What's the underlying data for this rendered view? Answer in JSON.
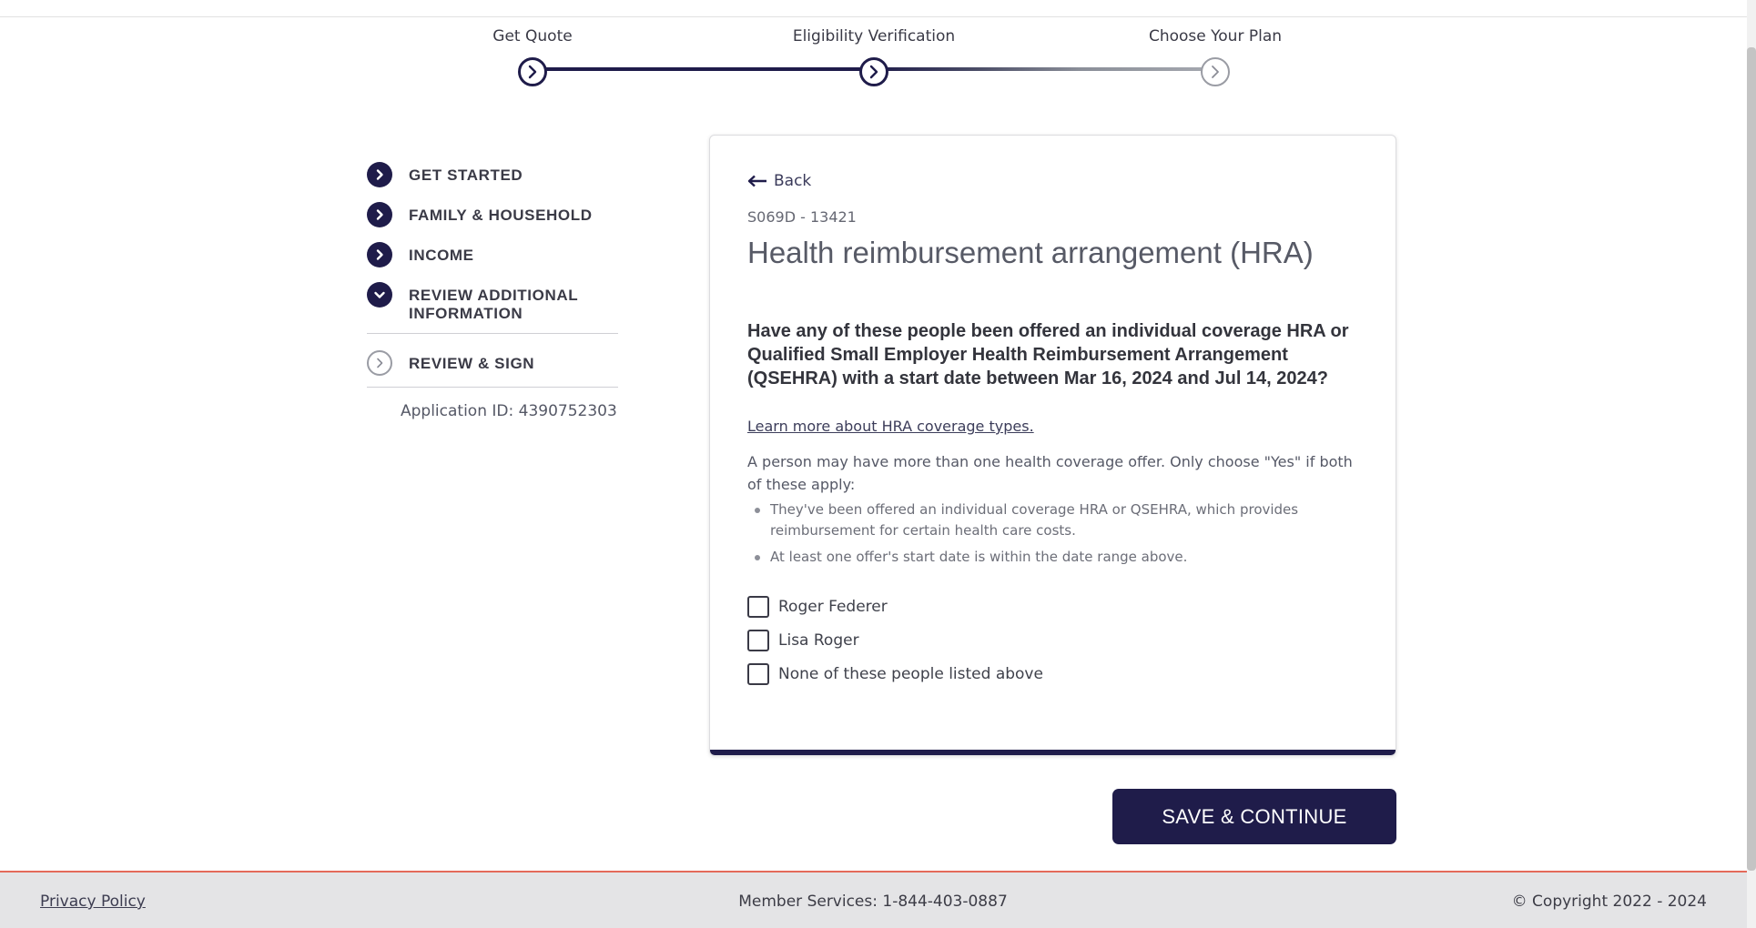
{
  "stepper": {
    "steps": [
      {
        "label": "Get Quote",
        "state": "done"
      },
      {
        "label": "Eligibility Verification",
        "state": "current"
      },
      {
        "label": "Choose Your Plan",
        "state": "upcoming"
      }
    ],
    "colors": {
      "active": "#1f1c4a",
      "inactive": "#9a9ca4"
    }
  },
  "sidebar": {
    "items": [
      {
        "label": "GET STARTED",
        "icon": "chevron-right-icon",
        "state": "complete"
      },
      {
        "label": "FAMILY & HOUSEHOLD",
        "icon": "chevron-right-icon",
        "state": "complete"
      },
      {
        "label": "INCOME",
        "icon": "chevron-right-icon",
        "state": "complete"
      },
      {
        "label": "REVIEW ADDITIONAL INFORMATION",
        "icon": "chevron-down-icon",
        "state": "expanded"
      },
      {
        "label": "REVIEW & SIGN",
        "icon": "chevron-right-icon",
        "state": "upcoming"
      }
    ],
    "application_id": "Application ID: 4390752303"
  },
  "card": {
    "back_label": "Back",
    "form_code": "S069D - 13421",
    "title": "Health reimbursement arrangement (HRA)",
    "question": "Have any of these people been offered an individual coverage HRA or Qualified Small Employer Health Reimbursement Arrangement (QSEHRA) with a start date between Mar 16, 2024 and Jul 14, 2024?",
    "learn_more": "Learn more about HRA coverage types.",
    "explanation": "A person may have more than one health coverage offer. Only choose \"Yes\" if both of these apply:",
    "bullets": [
      "They've been offered an individual coverage HRA or QSEHRA, which provides reimbursement for certain health care costs.",
      "At least one offer's start date is within the date range above."
    ],
    "options": [
      {
        "label": "Roger Federer",
        "checked": false
      },
      {
        "label": "Lisa Roger",
        "checked": false
      },
      {
        "label": "None of these people listed above",
        "checked": false
      }
    ]
  },
  "save_button": "SAVE & CONTINUE",
  "footer": {
    "privacy": "Privacy Policy",
    "member_services": "Member Services: 1-844-403-0887",
    "copyright": "© Copyright 2022 - 2024"
  },
  "colors": {
    "brand": "#1f1c4a",
    "footer_bg": "#e4e4e6",
    "footer_accent": "#e46a5a"
  }
}
